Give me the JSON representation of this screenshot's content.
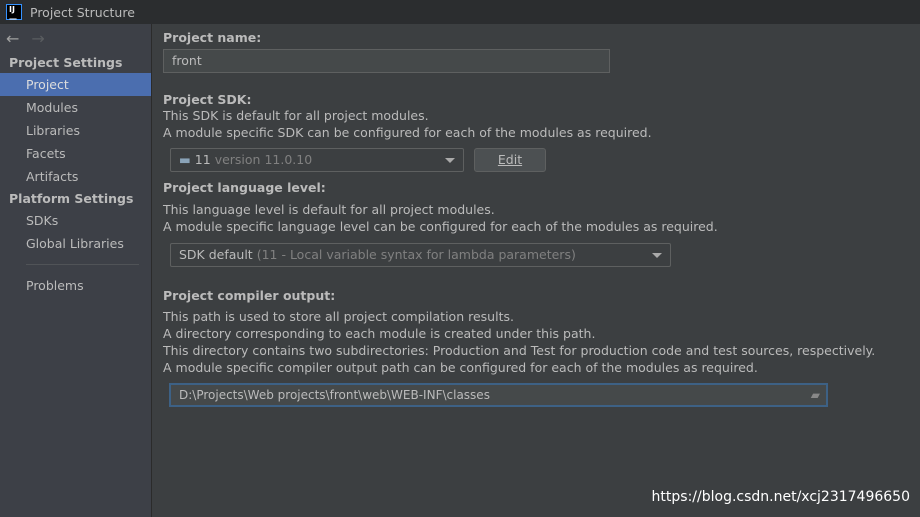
{
  "window": {
    "title": "Project Structure",
    "logo": "IJ"
  },
  "sidebar": {
    "groups": [
      {
        "label": "Project Settings",
        "items": [
          "Project",
          "Modules",
          "Libraries",
          "Facets",
          "Artifacts"
        ]
      },
      {
        "label": "Platform Settings",
        "items": [
          "SDKs",
          "Global Libraries"
        ]
      }
    ],
    "problems": "Problems",
    "selected": "Project"
  },
  "main": {
    "name_label": "Project name:",
    "name_value": "front",
    "sdk_label": "Project SDK:",
    "sdk_desc1": "This SDK is default for all project modules.",
    "sdk_desc2": "A module specific SDK can be configured for each of the modules as required.",
    "sdk_value": "11",
    "sdk_version": "version 11.0.10",
    "edit_label": "Edit",
    "lang_label": "Project language level:",
    "lang_desc1": "This language level is default for all project modules.",
    "lang_desc2": "A module specific language level can be configured for each of the modules as required.",
    "lang_value": "SDK default",
    "lang_detail": "(11 - Local variable syntax for lambda parameters)",
    "out_label": "Project compiler output:",
    "out_desc1": "This path is used to store all project compilation results.",
    "out_desc2": "A directory corresponding to each module is created under this path.",
    "out_desc3": "This directory contains two subdirectories: Production and Test for production code and test sources, respectively.",
    "out_desc4": "A module specific compiler output path can be configured for each of the modules as required.",
    "out_value": "D:\\Projects\\Web projects\\front\\web\\WEB-INF\\classes"
  },
  "watermark": "https://blog.csdn.net/xcj2317496650",
  "colors": {
    "selection": "#4b6eaf",
    "focus": "#3d6185"
  }
}
